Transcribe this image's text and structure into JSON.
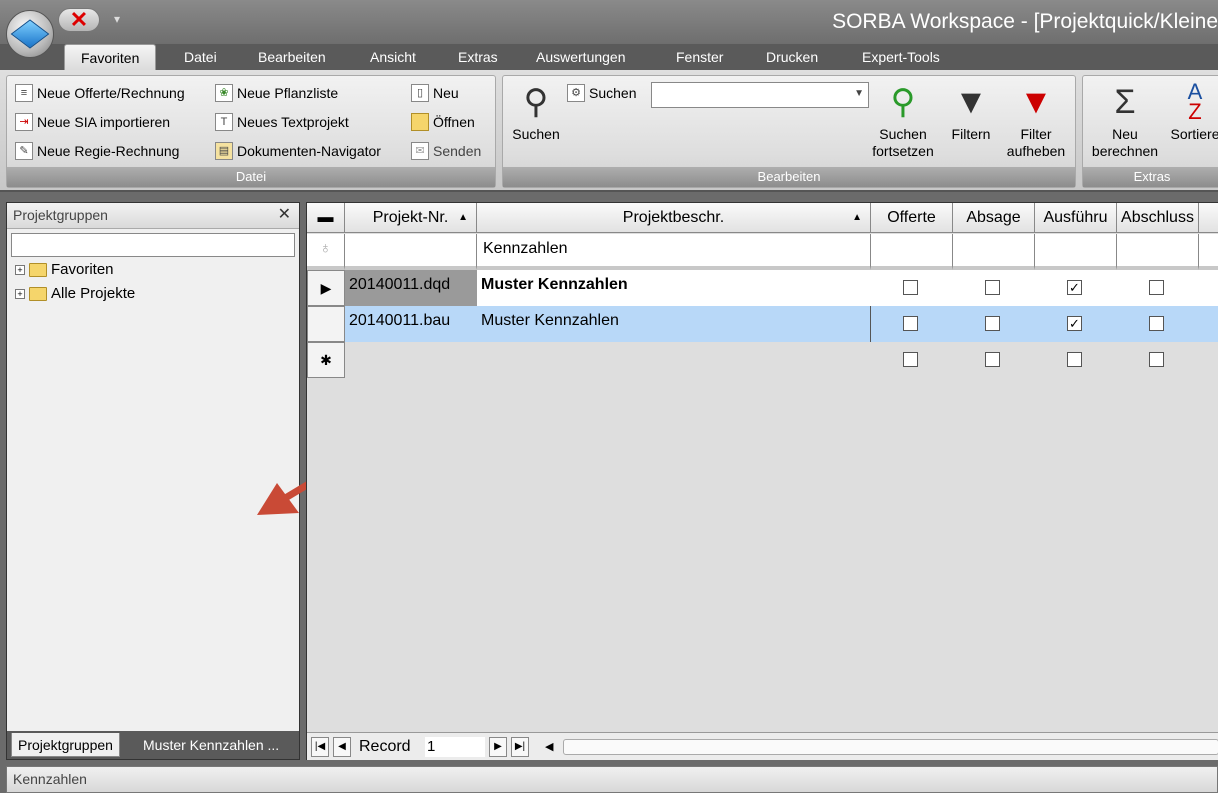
{
  "window": {
    "title": "SORBA Workspace - [Projektquick/Kleine"
  },
  "quick_access": {
    "close_glyph": "✕",
    "dropdown_glyph": "▾"
  },
  "tabs": [
    {
      "label": "Favoriten"
    },
    {
      "label": "Datei"
    },
    {
      "label": "Bearbeiten"
    },
    {
      "label": "Ansicht"
    },
    {
      "label": "Extras"
    },
    {
      "label": "Auswertungen"
    },
    {
      "label": "Fenster"
    },
    {
      "label": "Drucken"
    },
    {
      "label": "Expert-Tools"
    }
  ],
  "ribbon": {
    "datei": {
      "label": "Datei",
      "items": [
        {
          "label": "Neue Offerte/Rechnung",
          "icon": "document-icon"
        },
        {
          "label": "Neue SIA importieren",
          "icon": "import-icon"
        },
        {
          "label": "Neue Regie-Rechnung",
          "icon": "invoice-icon"
        },
        {
          "label": "Neue Pflanzliste",
          "icon": "plant-icon"
        },
        {
          "label": "Neues Textprojekt",
          "icon": "text-icon"
        },
        {
          "label": "Dokumenten-Navigator",
          "icon": "navigator-icon"
        },
        {
          "label": "Neu",
          "icon": "new-file-icon"
        },
        {
          "label": "Öffnen",
          "icon": "folder-open-icon"
        },
        {
          "label": "Senden",
          "icon": "mail-icon"
        }
      ]
    },
    "bearbeiten": {
      "label": "Bearbeiten",
      "search_label": "Suchen",
      "search_value": "",
      "suchen": "Suchen",
      "suchen_fortsetzen_1": "Suchen",
      "suchen_fortsetzen_2": "fortsetzen",
      "filtern": "Filtern",
      "filter_aufheben_1": "Filter",
      "filter_aufheben_2": "aufheben"
    },
    "extras": {
      "label": "Extras",
      "neu_berechnen_1": "Neu",
      "neu_berechnen_2": "berechnen",
      "sortieren": "Sortiere"
    }
  },
  "left_panel": {
    "title": "Projektgruppen",
    "close_glyph": "✕",
    "filter_value": "",
    "tree": [
      {
        "label": "Favoriten"
      },
      {
        "label": "Alle Projekte"
      }
    ],
    "bottom_tabs": [
      {
        "label": "Projektgruppen"
      },
      {
        "label": "Muster Kennzahlen ..."
      }
    ]
  },
  "grid": {
    "columns": {
      "collapse_glyph": "▬",
      "projekt_nr": "Projekt-Nr.",
      "projektbeschr": "Projektbeschr.",
      "offerte": "Offerte",
      "absage": "Absage",
      "ausfuehrung": "Ausführu",
      "abschluss": "Abschluss"
    },
    "filter_row": {
      "projektbeschr": "Kennzahlen"
    },
    "rows": [
      {
        "nr": "20140011.dqd",
        "beschr": "Muster Kennzahlen",
        "offerte": false,
        "absage": false,
        "ausfuehrung": true,
        "abschluss": false,
        "selector": "▶"
      },
      {
        "nr": "20140011.bau",
        "beschr": "Muster Kennzahlen",
        "offerte": false,
        "absage": false,
        "ausfuehrung": true,
        "abschluss": false,
        "selector": ""
      }
    ],
    "new_row_selector": "✱",
    "navigator": {
      "label": "Record",
      "value": "1"
    }
  },
  "status_bar": {
    "text": "Kennzahlen"
  },
  "colors": {
    "selected_row": "#b8d8f8",
    "annotation_arrow": "#c94a36"
  }
}
